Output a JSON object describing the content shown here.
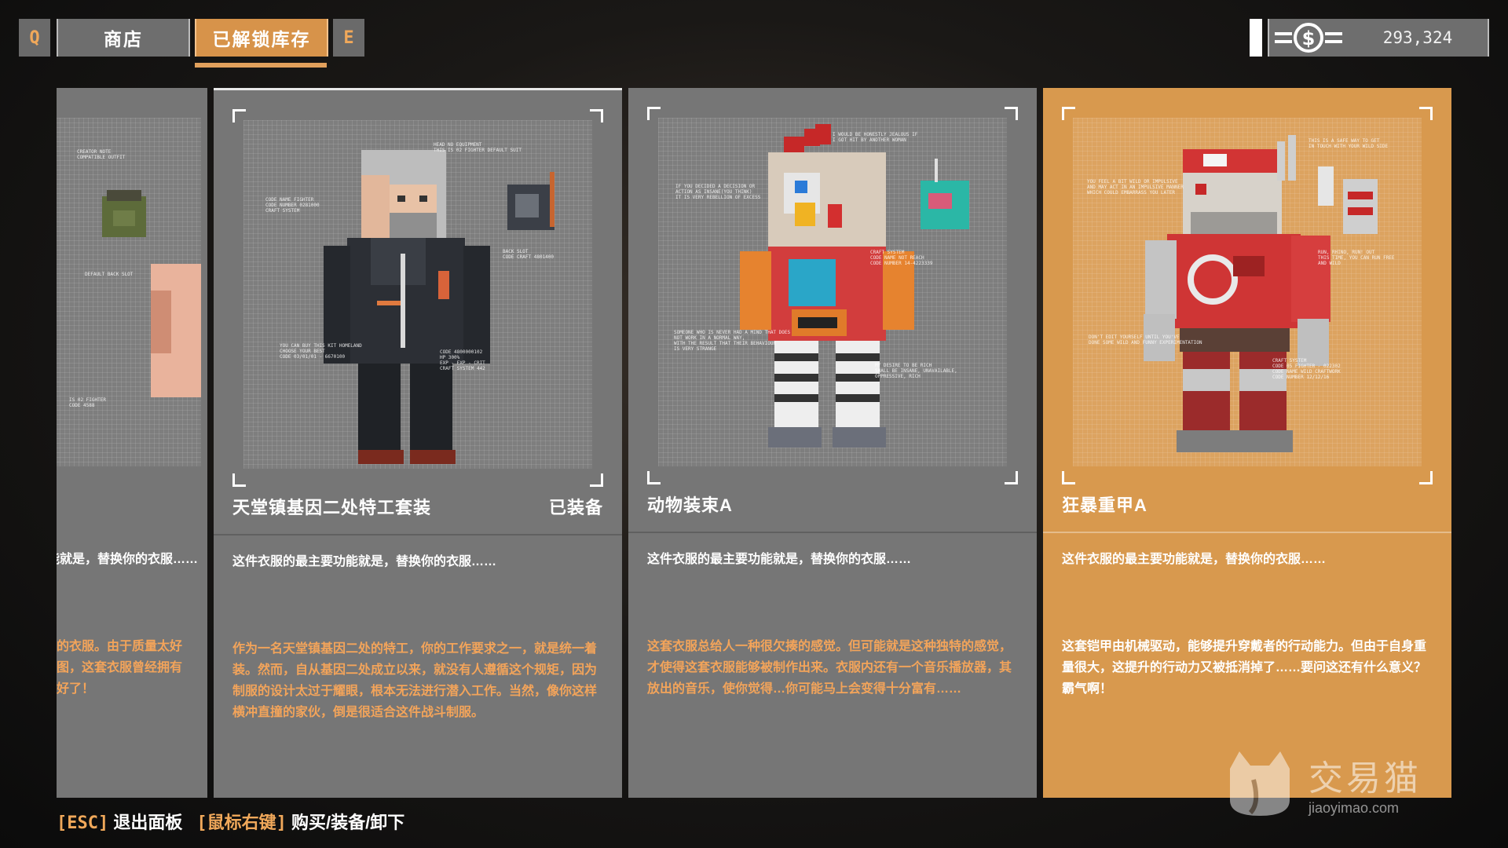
{
  "topbar": {
    "prev_key": "Q",
    "next_key": "E",
    "tabs": [
      {
        "label": "商店",
        "active": false
      },
      {
        "label": "已解锁库存",
        "active": true
      }
    ],
    "currency_icon": "dollar-coin-icon",
    "currency_value": "293,324"
  },
  "cards": [
    {
      "partial": true,
      "summary": "这件衣服的最主要功能就是，替换你的衣服……",
      "desc_lines": [
        "的衣服。由于质量太好",
        "图，这套衣服曾经拥有",
        "好了！"
      ]
    },
    {
      "name": "天堂镇基因二处特工套装",
      "status": "已装备",
      "summary": "这件衣服的最主要功能就是，替换你的衣服……",
      "desc": "作为一名天堂镇基因二处的特工，你的工作要求之一，就是统一着装。然而，自从基因二处成立以来，就没有人遵循这个规矩，因为制服的设计太过于耀眼，根本无法进行潜入工作。当然，像你这样横冲直撞的家伙，倒是很适合这件战斗制服。"
    },
    {
      "name": "动物装束A",
      "summary": "这件衣服的最主要功能就是，替换你的衣服……",
      "desc": "这套衣服总给人一种很欠揍的感觉。但可能就是这种独特的感觉，才使得这套衣服能够被制作出来。衣服内还有一个音乐播放器，其放出的音乐，使你觉得…你可能马上会变得十分富有……"
    },
    {
      "name": "狂暴重甲A",
      "summary": "这件衣服的最主要功能就是，替换你的衣服……",
      "desc": "这套铠甲由机械驱动，能够提升穿戴者的行动能力。但由于自身重量很大，这提升的行动力又被抵消掉了……要问这还有什么意义？霸气啊！"
    }
  ],
  "help": {
    "esc_key": "[ESC]",
    "esc_label": "退出面板",
    "mouse_key": "[鼠标右键]",
    "mouse_label": "购买/装备/卸下"
  },
  "watermark": {
    "cn": "交易猫",
    "url": "jiaoyimao.com"
  },
  "colors": {
    "accent": "#d7934a",
    "card": "#767676",
    "orange_text": "#f3a45a"
  }
}
